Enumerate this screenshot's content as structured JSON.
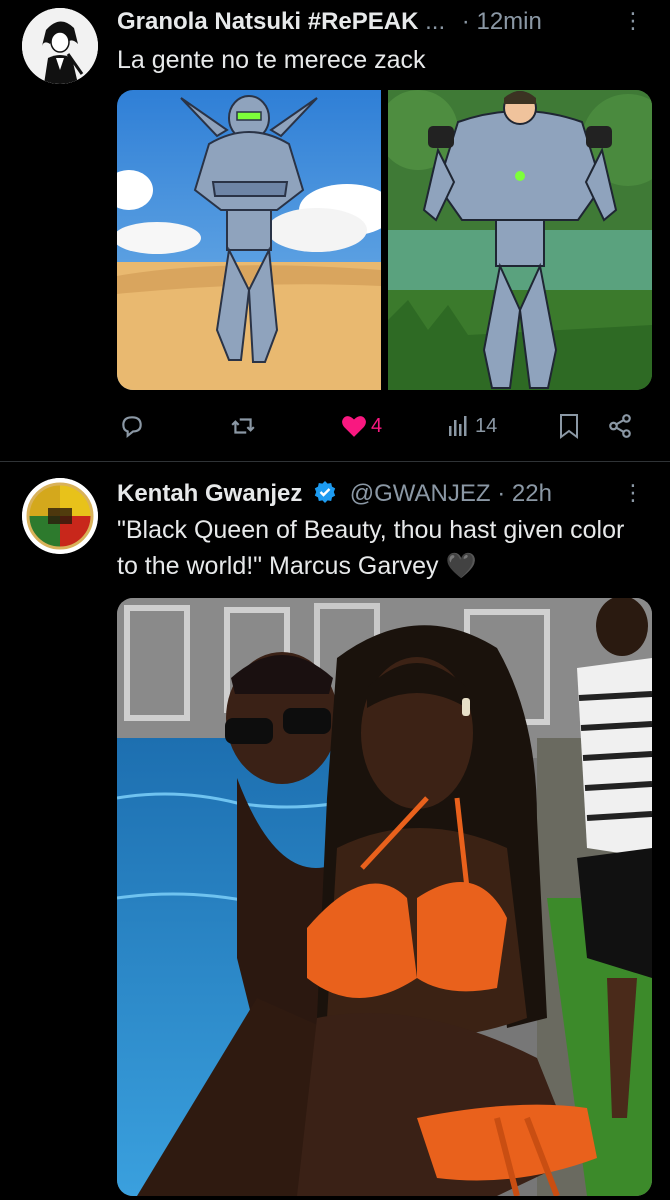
{
  "tweet1": {
    "display_name": "Granola Natsuki #RePEAK",
    "ellipsis": "...",
    "separator": "·",
    "time": "12min",
    "more": "⋮",
    "text": "La gente no te merece zack",
    "likes": "4",
    "views": "14"
  },
  "tweet2": {
    "display_name": "Kentah Gwanjez",
    "handle": "@GWANJEZ",
    "separator": "·",
    "time": "22h",
    "more": "⋮",
    "text": "\"Black Queen of Beauty, thou hast given color to the world!\" Marcus Garvey",
    "heart_emoji": "🖤"
  },
  "colors": {
    "like_pink": "#f91880",
    "verified_blue": "#1d9bf0",
    "muted": "#8b98a5"
  }
}
